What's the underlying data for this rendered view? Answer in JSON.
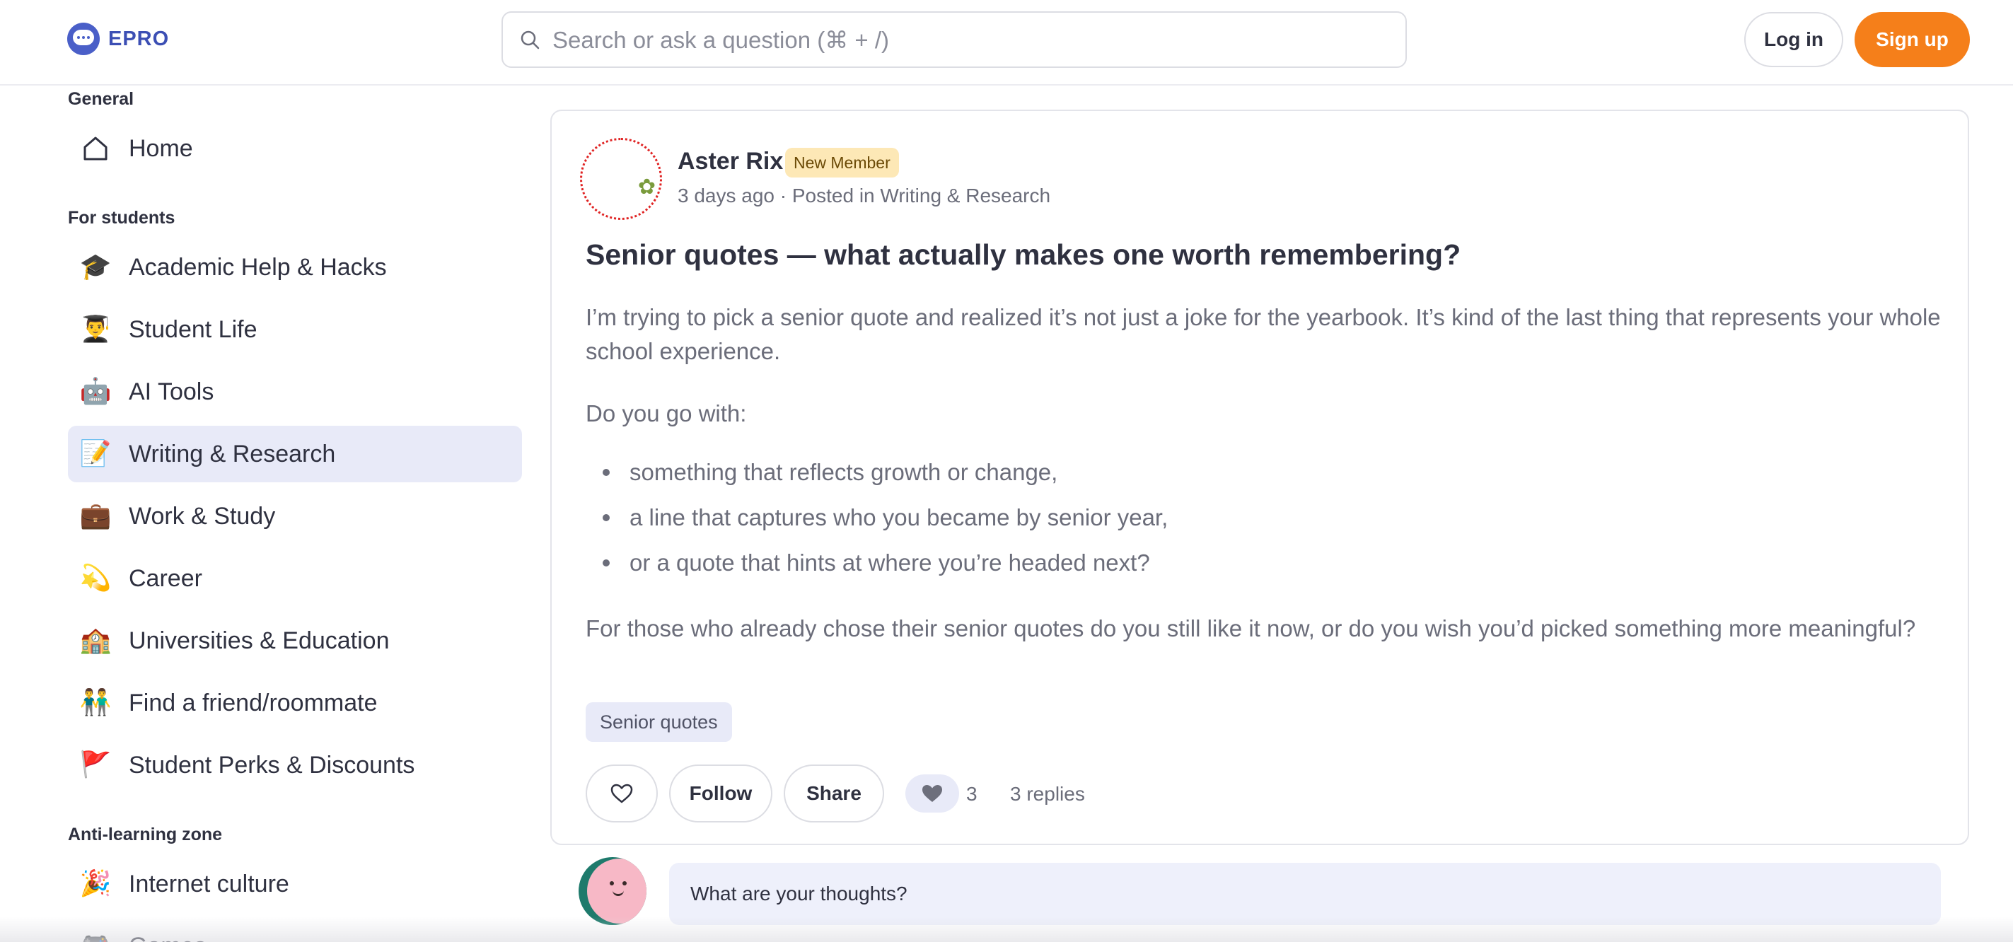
{
  "header": {
    "logo_text": "EPRO",
    "search_placeholder": "Search or ask a question (⌘ + /)",
    "login_label": "Log in",
    "signup_label": "Sign up"
  },
  "sidebar": {
    "sections": [
      {
        "title": "General"
      },
      {
        "title": "For students"
      },
      {
        "title": "Anti-learning zone"
      }
    ],
    "items": [
      {
        "label": "Home",
        "icon": "home-icon",
        "emoji": ""
      },
      {
        "label": "Academic Help & Hacks",
        "icon": "graduation-cap-icon",
        "emoji": "🎓"
      },
      {
        "label": "Student Life",
        "icon": "student-icon",
        "emoji": "👨‍🎓"
      },
      {
        "label": "AI Tools",
        "icon": "robot-icon",
        "emoji": "🤖"
      },
      {
        "label": "Writing & Research",
        "icon": "memo-icon",
        "emoji": "📝",
        "active": true
      },
      {
        "label": "Work & Study",
        "icon": "briefcase-icon",
        "emoji": "💼"
      },
      {
        "label": "Career",
        "icon": "dizzy-star-icon",
        "emoji": "💫"
      },
      {
        "label": "Universities & Education",
        "icon": "school-icon",
        "emoji": "🏫"
      },
      {
        "label": "Find a friend/roommate",
        "icon": "people-icon",
        "emoji": "👬"
      },
      {
        "label": "Student Perks & Discounts",
        "icon": "flag-icon",
        "emoji": "🚩"
      },
      {
        "label": "Internet culture",
        "icon": "party-popper-icon",
        "emoji": "🎉"
      },
      {
        "label": "Games",
        "icon": "gamepad-icon",
        "emoji": "🎮"
      }
    ]
  },
  "post": {
    "author": "Aster Rix",
    "author_badge": "New Member",
    "meta": "3 days ago · Posted in Writing & Research",
    "title": "Senior quotes — what actually makes one worth remembering?",
    "paragraph1": "I’m trying to pick a senior quote and realized it’s not just a joke for the yearbook. It’s kind of the last thing that represents your whole school experience.",
    "paragraph2": "Do you go with:",
    "bullets": [
      "something that reflects growth or change,",
      "a line that captures who you became by senior year,",
      "or a quote that hints at where you’re headed next?"
    ],
    "paragraph3": "For those who already chose their senior quotes do you still like it now, or do you wish you’d picked something more meaningful?",
    "tag": "Senior quotes",
    "follow_label": "Follow",
    "share_label": "Share",
    "like_count": "3",
    "replies_label": "3 replies"
  },
  "reply": {
    "placeholder": "What are your thoughts?"
  },
  "colors": {
    "brand": "#3c4fb4",
    "accent": "#f57f1a",
    "active_nav": "#e8eaf8",
    "badge_bg": "#fde8b6"
  }
}
